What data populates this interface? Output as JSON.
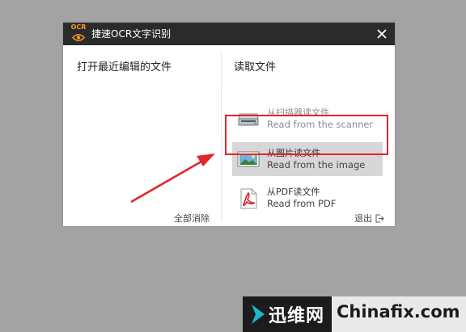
{
  "window": {
    "title": "捷速OCR文字识别",
    "logo_text": "OCR"
  },
  "left_pane": {
    "title": "打开最近编辑的文件",
    "clear_all": "全部消除"
  },
  "right_pane": {
    "title": "读取文件",
    "items": [
      {
        "label": "从扫描器读文件",
        "sublabel": "Read from the scanner",
        "icon": "scanner-icon",
        "state": "disabled"
      },
      {
        "label": "从图片读文件",
        "sublabel": "Read from the image",
        "icon": "image-icon",
        "state": "selected"
      },
      {
        "label": "从PDF读文件",
        "sublabel": "Read from PDF",
        "icon": "pdf-icon",
        "state": "normal"
      }
    ],
    "exit": "退出"
  },
  "annotation": {
    "color": "#e0272b"
  },
  "watermark": {
    "cn": "迅维网",
    "en": "Chinafix.com"
  }
}
